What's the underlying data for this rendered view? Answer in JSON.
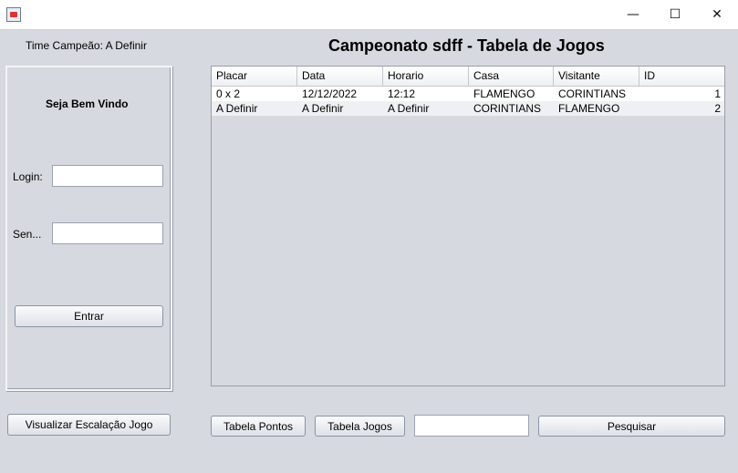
{
  "window": {
    "minimize": "—",
    "maximize": "☐",
    "close": "✕"
  },
  "champion_label": "Time Campeão: A Definir",
  "page_title": "Campeonato sdff - Tabela de Jogos",
  "login": {
    "welcome": "Seja Bem Vindo",
    "login_label": "Login:",
    "login_value": "",
    "password_label": "Sen...",
    "password_value": "",
    "enter_button": "Entrar"
  },
  "lineup_button": "Visualizar Escalação Jogo",
  "table": {
    "headers": [
      "Placar",
      "Data",
      "Horario",
      "Casa",
      "Visitante",
      "ID"
    ],
    "rows": [
      [
        "0 x 2",
        "12/12/2022",
        "12:12",
        "FLAMENGO",
        "CORINTIANS",
        "1"
      ],
      [
        "A Definir",
        "A Definir",
        "A Definir",
        "CORINTIANS",
        "FLAMENGO",
        "2"
      ]
    ]
  },
  "bottom": {
    "points_button": "Tabela Pontos",
    "games_button": "Tabela Jogos",
    "search_value": "",
    "search_button": "Pesquisar"
  }
}
